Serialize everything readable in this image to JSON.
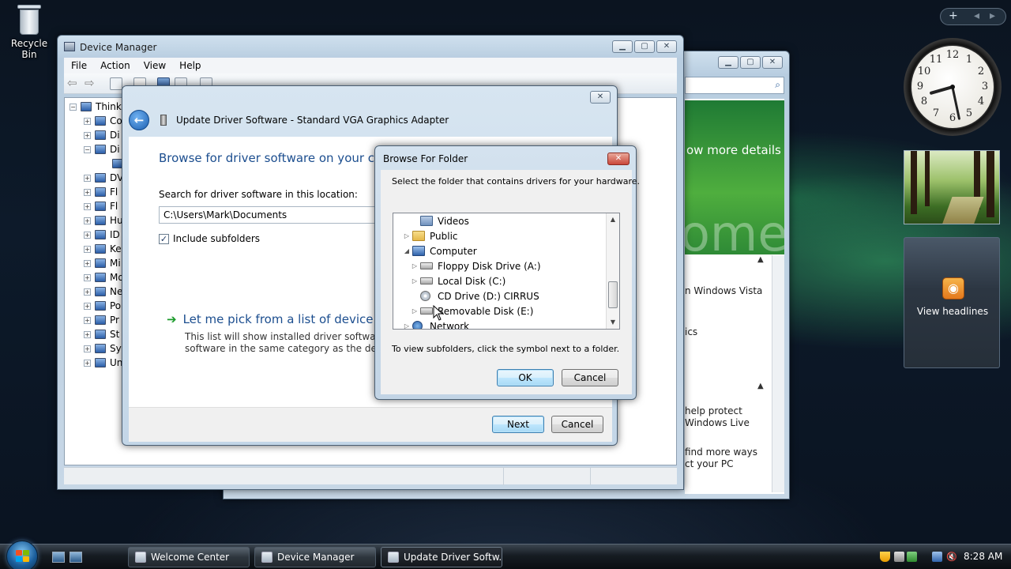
{
  "desktop": {
    "recycle_bin_label": "Recycle Bin"
  },
  "welcome_center": {
    "banner_text": "ow more details",
    "banner_big_word": "ome",
    "texts": [
      "n Windows Vista",
      "ics",
      "help protect",
      "Windows Live",
      "find more ways",
      "ct your PC"
    ]
  },
  "device_manager": {
    "title": "Device Manager",
    "menu": [
      "File",
      "Action",
      "View",
      "Help"
    ],
    "tree": {
      "root": "Think",
      "items": [
        "Co",
        "Di",
        "Di",
        "",
        "DV",
        "Fl",
        "Fl",
        "Hu",
        "ID",
        "Ke",
        "Mi",
        "Mo",
        "Ne",
        "Po",
        "Pr",
        "St",
        "Sy",
        "Un"
      ]
    }
  },
  "wizard": {
    "title": "Update Driver Software - Standard VGA Graphics Adapter",
    "heading": "Browse for driver software on your com",
    "search_label": "Search for driver software in this location:",
    "path_value": "C:\\Users\\Mark\\Documents",
    "include_subfolders_label": "Include subfolders",
    "include_subfolders_checked": true,
    "pick_link": "Let me pick from a list of device dri",
    "pick_desc_1": "This list will show installed driver software con",
    "pick_desc_2": "software in the same category as the device.",
    "next_label": "Next",
    "cancel_label": "Cancel"
  },
  "browse_folder": {
    "title": "Browse For Folder",
    "close_glyph": "✕",
    "instruction": "Select the folder that contains drivers for your hardware.",
    "tree": [
      {
        "label": "Videos",
        "icon": "video-icon",
        "expander": ""
      },
      {
        "label": "Public",
        "icon": "folder-icon",
        "expander": "▷"
      },
      {
        "label": "Computer",
        "icon": "computer-icon",
        "expander": "◢"
      },
      {
        "label": "Floppy Disk Drive (A:)",
        "icon": "floppy-drive-icon",
        "expander": "▷"
      },
      {
        "label": "Local Disk (C:)",
        "icon": "hard-drive-icon",
        "expander": "▷"
      },
      {
        "label": "CD Drive (D:) CIRRUS",
        "icon": "cd-drive-icon",
        "expander": ""
      },
      {
        "label": "Removable Disk (E:)",
        "icon": "removable-disk-icon",
        "expander": "▷"
      },
      {
        "label": "Network",
        "icon": "network-icon",
        "expander": "▷"
      }
    ],
    "hint": "To view subfolders, click the symbol next to a folder.",
    "ok_label": "OK",
    "cancel_label": "Cancel"
  },
  "gadgets": {
    "clock_time": "8:28",
    "feed_label": "View headlines",
    "sidebar_add": "+",
    "sidebar_prev": "◂",
    "sidebar_next": "▸"
  },
  "taskbar": {
    "buttons": [
      {
        "label": "Welcome Center",
        "active": false
      },
      {
        "label": "Device Manager",
        "active": false
      },
      {
        "label": "Update Driver Softw...",
        "active": true
      }
    ],
    "clock": "8:28 AM"
  },
  "colors": {
    "link_blue": "#1c4e8f",
    "arrow_green": "#1a9a2a",
    "close_red": "#c9463a"
  }
}
